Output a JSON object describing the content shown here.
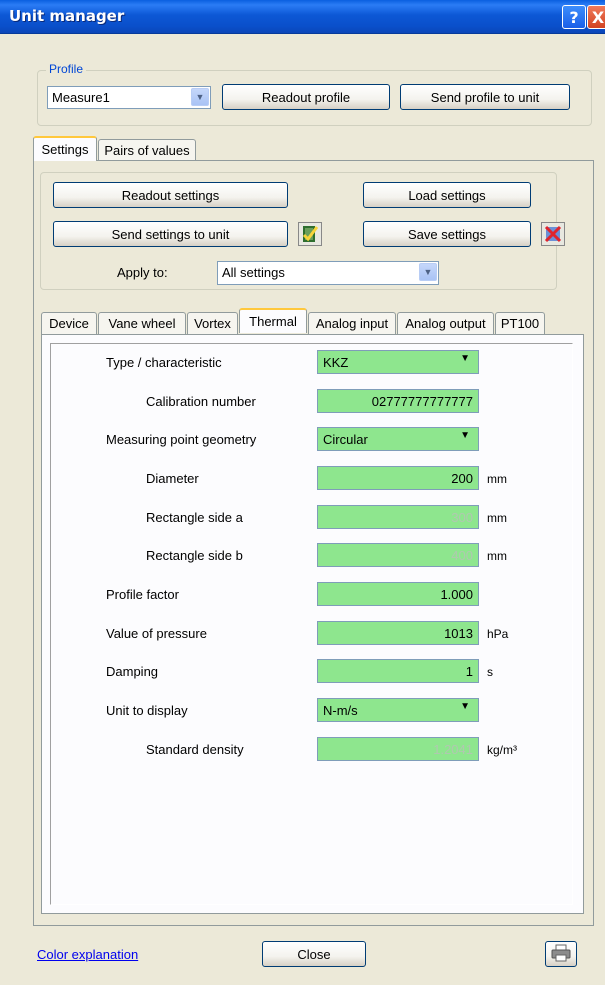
{
  "window": {
    "title": "Unit manager",
    "help_glyph": "?",
    "close_glyph": "X"
  },
  "profile": {
    "legend": "Profile",
    "selected": "Measure1",
    "readout_label": "Readout profile",
    "send_label": "Send profile to unit"
  },
  "main_tabs": [
    {
      "label": "Settings",
      "active": true
    },
    {
      "label": "Pairs of values",
      "active": false
    }
  ],
  "settings": {
    "readout_label": "Readout settings",
    "load_label": "Load settings",
    "send_label": "Send settings to unit",
    "save_label": "Save settings",
    "apply_to_label": "Apply to:",
    "apply_to_value": "All settings"
  },
  "sub_tabs": [
    {
      "label": "Device"
    },
    {
      "label": "Vane wheel"
    },
    {
      "label": "Vortex"
    },
    {
      "label": "Thermal",
      "active": true
    },
    {
      "label": "Analog input"
    },
    {
      "label": "Analog output"
    },
    {
      "label": "PT100"
    }
  ],
  "thermal": {
    "type_label": "Type / characteristic",
    "type_value": "KKZ",
    "calibration_label": "Calibration number",
    "calibration_value": "02777777777777",
    "geometry_label": "Measuring point geometry",
    "geometry_value": "Circular",
    "diameter_label": "Diameter",
    "diameter_value": "200",
    "diameter_unit": "mm",
    "rect_a_label": "Rectangle side a",
    "rect_a_value": "300",
    "rect_a_unit": "mm",
    "rect_b_label": "Rectangle side b",
    "rect_b_value": "400",
    "rect_b_unit": "mm",
    "profile_factor_label": "Profile factor",
    "profile_factor_value": "1.000",
    "pressure_label": "Value of pressure",
    "pressure_value": "1013",
    "pressure_unit": "hPa",
    "damping_label": "Damping",
    "damping_value": "1",
    "damping_unit": "s",
    "unit_display_label": "Unit to display",
    "unit_display_value": "N-m/s",
    "density_label": "Standard density",
    "density_value": "1.2041",
    "density_unit": "kg/m³"
  },
  "footer": {
    "color_link": "Color explanation",
    "close_label": "Close"
  },
  "colors": {
    "field_green": "#8ee68e",
    "title_blue": "#0a4fca",
    "legend_blue": "#0046d5"
  },
  "icons": [
    "help-icon",
    "close-icon",
    "dropdown-arrow-icon",
    "send-check-icon",
    "save-cancel-icon",
    "printer-icon"
  ]
}
